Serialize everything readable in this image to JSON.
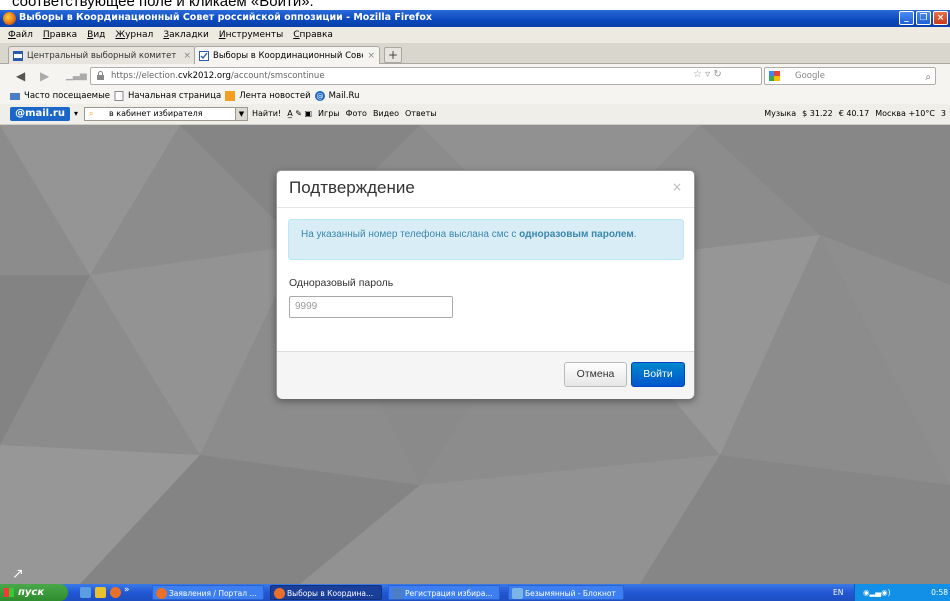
{
  "caption": "соответствующее поле и кликаем «Войти».",
  "window": {
    "title": "Выборы в Координационный Совет российской оппозиции - Mozilla Firefox",
    "buttons": [
      "_",
      "❐",
      "×"
    ]
  },
  "menu": [
    "Файл",
    "Правка",
    "Вид",
    "Журнал",
    "Закладки",
    "Инструменты",
    "Справка"
  ],
  "tabs": [
    {
      "label": "Центральный выборный комитет выб...",
      "close": "×"
    },
    {
      "label": "Выборы в Координационный Совет ро...",
      "close": "×"
    }
  ],
  "new_tab_label": "+",
  "nav": {
    "url_prefix": "https://election.",
    "url_host": "cvk2012.org",
    "url_path": "/account/smscontinue",
    "search_placeholder": "Google"
  },
  "bookmarks": [
    "Часто посещаемые",
    "Начальная страница",
    "Лента новостей",
    "Mail.Ru"
  ],
  "mailbar": {
    "logo": "@mail.ru",
    "search_value": "в кабинет избирателя",
    "find_label": "Найти!",
    "items": [
      "Игры",
      "Фото",
      "Видео",
      "Ответы"
    ],
    "right_items": [
      "Музыка",
      "$ 31.22",
      "€ 40.17",
      "Москва +10°C",
      "3"
    ]
  },
  "modal": {
    "title": "Подтверждение",
    "close": "×",
    "alert_pre": "На указанный номер телефона выслана смс с ",
    "alert_bold": "одноразовым паролем",
    "alert_post": ".",
    "field_label": "Одноразовый пароль",
    "field_value": "9999",
    "cancel": "Отмена",
    "submit": "Войти"
  },
  "taskbar": {
    "start": "пуск",
    "more": "»",
    "tasks": [
      {
        "label": "Заявления / Портал ..."
      },
      {
        "label": "Выборы в Координа..."
      },
      {
        "label": "Регистрация избира..."
      },
      {
        "label": "Безымянный - Блокнот"
      }
    ],
    "lang": "EN",
    "time": "0:58"
  }
}
